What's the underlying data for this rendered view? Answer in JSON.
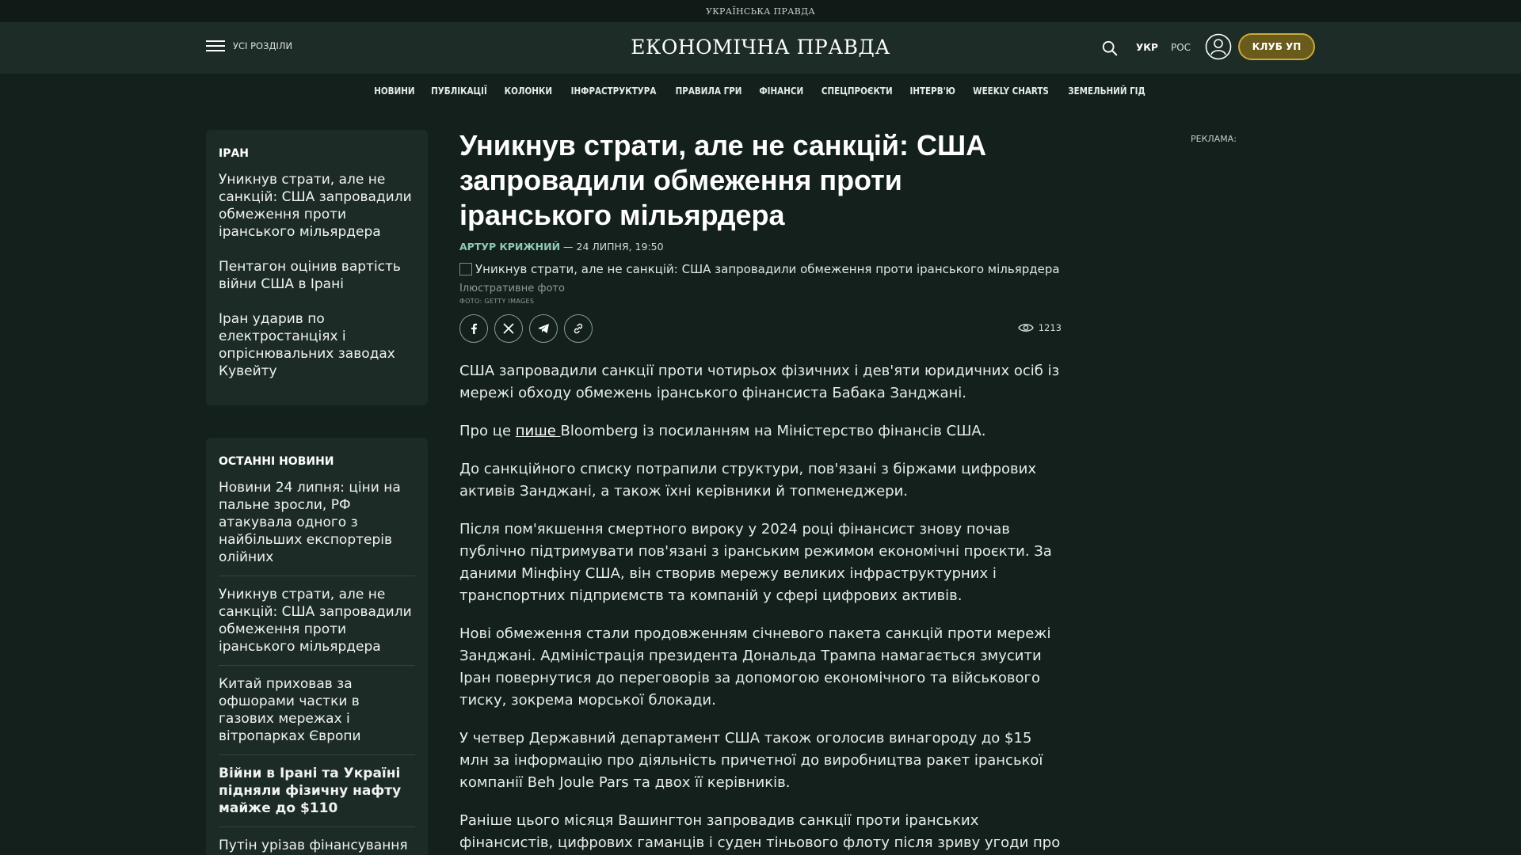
{
  "topstrip": {
    "label": "УКРАЇНСЬКА ПРАВДА"
  },
  "header": {
    "menu_label": "УСІ РОЗДІЛИ",
    "logo": "ЕКОНОМІЧНА ПРАВДА",
    "lang_ukr": "УКР",
    "lang_ros": "РОС",
    "club_label": "КЛУБ УП"
  },
  "nav": {
    "items": [
      "НОВИНИ",
      "ПУБЛІКАЦІЇ",
      "КОЛОНКИ",
      "ІНФРАСТРУКТУРА",
      "ПРАВИЛА ГРИ",
      "ФІНАНСИ",
      "СПЕЦПРОЄКТИ",
      "ІНТЕРВ'Ю",
      "WEEKLY CHARTS",
      "ЗЕМЕЛЬНИЙ ГІД"
    ]
  },
  "iran_block": {
    "title": "ІРАН",
    "items": [
      "Уникнув страти, але не санкцій: США запровадили обмеження проти іранського мільярдера",
      "Пентагон оцінив вартість війни США в Ірані",
      "Іран ударив по електростанціях і опріснювальних заводах Кувейту"
    ]
  },
  "latest": {
    "title": "ОСТАННІ НОВИНИ",
    "items": [
      "Новини 24 липня: ціни на пальне зросли, РФ атакувала одного з найбільших експортерів олійних",
      "Уникнув страти, але не санкцій: США запровадили обмеження проти іранського мільярдера",
      "Китай приховав за офшорами частки в газових мережах і вітропарках Європи",
      "Війни в Ірані та Україні підняли фізичну нафту майже до $110",
      "Путін урізав фінансування проєктів \"Ростех\" і..."
    ]
  },
  "article": {
    "headline": "Уникнув страти, але не санкцій: США запровадили обмеження проти іранського мільярдера",
    "author": "АРТУР КРИЖНИЙ",
    "date_sep": " — ",
    "date": "24 ЛИПНЯ, 19:50",
    "image_alt": "Уникнув страти, але не санкцій: США запровадили обмеження проти іранського мільярдера",
    "caption": "Ілюстративне фото",
    "credit": "ФОТО: GETTY IMAGES",
    "views": "1213",
    "p1": "США запровадили санкції проти чотирьох фізичних і дев'яти юридичних осіб із мережі обходу обмежень іранського фінансиста Бабака Занджані.",
    "p2_before": "Про це ",
    "p2_link": "пише ",
    "p2_after": "Bloomberg із посиланням на Міністерство фінансів США.",
    "p3": "До санкційного списку потрапили структури, пов'язані з біржами цифрових активів Занджані, а також їхні керівники й топменеджери.",
    "p4": "Після пом'якшення смертного вироку у 2024 році фінансист знову почав публічно підтримувати пов'язані з іранським режимом економічні проєкти. За даними Мінфіну США, він створив мережу великих інфраструктурних і транспортних підприємств та компаній у сфері цифрових активів.",
    "p5": "Нові обмеження стали продовженням січневого пакета санкцій проти мережі Занджані. Адміністрація президента Дональда Трампа намагається змусити Іран повернутися до переговорів за допомогою економічного та військового тиску, зокрема морської блокади.",
    "p6": "У четвер Державний департамент США також оголосив винагороду до $15 млн за інформацію про діяльність причетної до виробництва ракет іранської компанії Beh Joule Pars та двох її керівників.",
    "p7": "Раніше цього місяця Вашингтон запровадив санкції проти іранських фінансистів, цифрових гаманців і суден тіньового флоту після зриву угоди про припинення"
  },
  "ad": {
    "label": "РЕКЛАМА:"
  },
  "colors": {
    "background": "#13201c",
    "header": "#1e2c28",
    "card": "#1d2b27",
    "accent_author": "#8fc9b7",
    "club_border": "#c9a93a"
  }
}
